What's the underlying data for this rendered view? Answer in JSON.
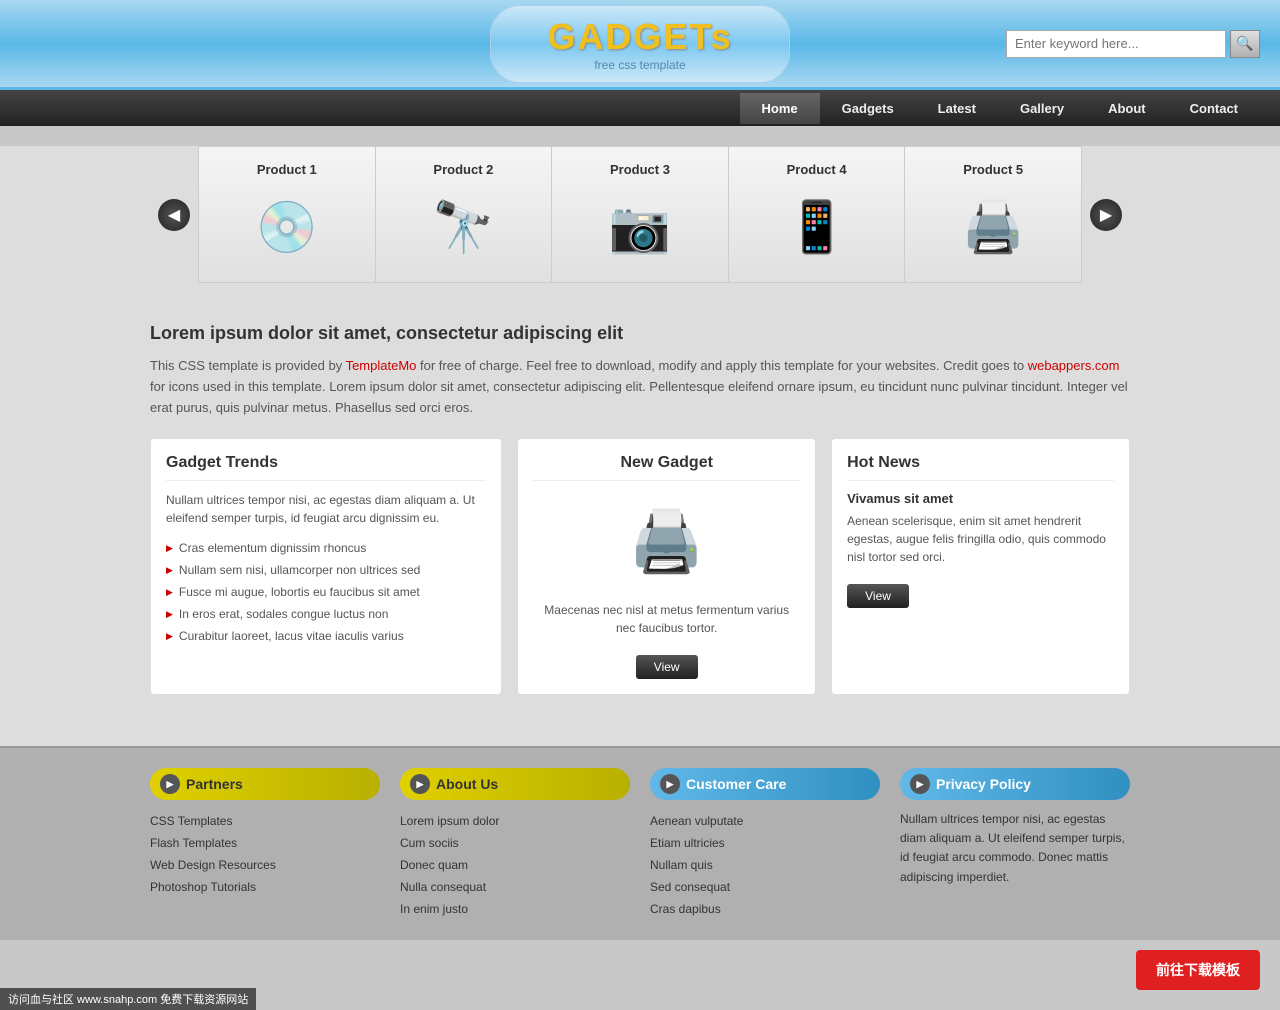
{
  "header": {
    "logo_title": "GADGETs",
    "logo_subtitle": "free css template",
    "search_placeholder": "Enter keyword here...",
    "search_btn_icon": "🔍"
  },
  "nav": {
    "items": [
      {
        "label": "Home",
        "active": true
      },
      {
        "label": "Gadgets",
        "active": false
      },
      {
        "label": "Latest",
        "active": false
      },
      {
        "label": "Gallery",
        "active": false
      },
      {
        "label": "About",
        "active": false
      },
      {
        "label": "Contact",
        "active": false
      }
    ]
  },
  "carousel": {
    "prev_label": "◀",
    "next_label": "▶",
    "items": [
      {
        "title": "Product 1",
        "icon": "💿"
      },
      {
        "title": "Product 2",
        "icon": "🔭"
      },
      {
        "title": "Product 3",
        "icon": "📷"
      },
      {
        "title": "Product 4",
        "icon": "📱"
      },
      {
        "title": "Product 5",
        "icon": "🖨️"
      }
    ]
  },
  "main": {
    "heading": "Lorem ipsum dolor sit amet, consectetur adipiscing elit",
    "body_text": "This CSS template is provided by TemplateMo for free of charge. Feel free to download, modify and apply this template for your websites. Credit goes to webappers.com for icons used in this template. Lorem ipsum dolor sit amet, consectetur adipiscing elit. Pellentesque eleifend ornare ipsum, eu tincidunt nunc pulvinar tincidunt. Integer vel erat purus, quis pulvinar metus. Phasellus sed orci eros.",
    "template_mo": "TemplateMo",
    "webappers": "webappers.com"
  },
  "gadget_trends": {
    "title": "Gadget Trends",
    "intro": "Nullam ultrices tempor nisi, ac egestas diam aliquam a. Ut eleifend semper turpis, id feugiat arcu dignissim eu.",
    "items": [
      "Cras elementum dignissim rhoncus",
      "Nullam sem nisi, ullamcorper non ultrices sed",
      "Fusce mi augue, lobortis eu faucibus sit amet",
      "In eros erat, sodales congue luctus non",
      "Curabitur laoreet, lacus vitae iaculis varius"
    ]
  },
  "new_gadget": {
    "title": "New Gadget",
    "icon": "🖨️",
    "text": "Maecenas nec nisl at metus fermentum varius nec faucibus tortor.",
    "view_btn": "View"
  },
  "hot_news": {
    "title": "Hot News",
    "subtitle": "Vivamus sit amet",
    "text": "Aenean scelerisque, enim sit amet hendrerit egestas, augue felis fringilla odio, quis commodo nisl tortor sed orci.",
    "view_btn": "View"
  },
  "footer": {
    "partners": {
      "title": "Partners",
      "links": [
        "CSS Templates",
        "Flash Templates",
        "Web Design Resources",
        "Photoshop Tutorials"
      ]
    },
    "about_us": {
      "title": "About Us",
      "links": [
        "Lorem ipsum dolor",
        "Cum sociis",
        "Donec quam",
        "Nulla consequat",
        "In enim justo"
      ]
    },
    "customer_care": {
      "title": "Customer Care",
      "links": [
        "Aenean vulputate",
        "Etiam ultricies",
        "Nullam quis",
        "Sed consequat",
        "Cras dapibus"
      ]
    },
    "privacy_policy": {
      "title": "Privacy Policy",
      "text": "Nullam ultrices tempor nisi, ac egestas diam aliquam a. Ut eleifend semper turpis, id feugiat arcu commodo. Donec mattis adipiscing imperdiet."
    }
  },
  "download_banner": "前往下载模板",
  "watermark": "访问血与社区 www.snahp.com 免费下载资源网站"
}
